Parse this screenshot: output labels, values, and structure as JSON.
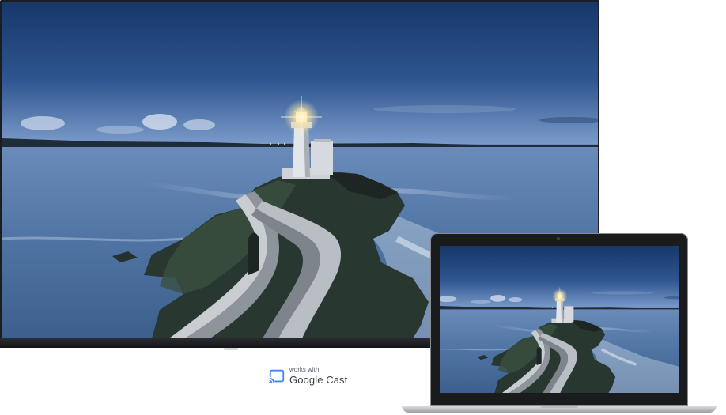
{
  "cast_badge": {
    "line1": "works with",
    "line2": "Google Cast",
    "icon": "cast-icon",
    "icon_color": "#4285f4"
  },
  "scene": {
    "sky_top": "#1d3f76",
    "sky_horizon": "#6c8fbf",
    "sea": "#5b7fab",
    "surf": "#e8eef7",
    "rock": "#2c3a34",
    "lighthouse": "#d9dde3",
    "lamp": "#fff4c8"
  },
  "devices": {
    "tv": "tv-display",
    "laptop": "laptop"
  }
}
